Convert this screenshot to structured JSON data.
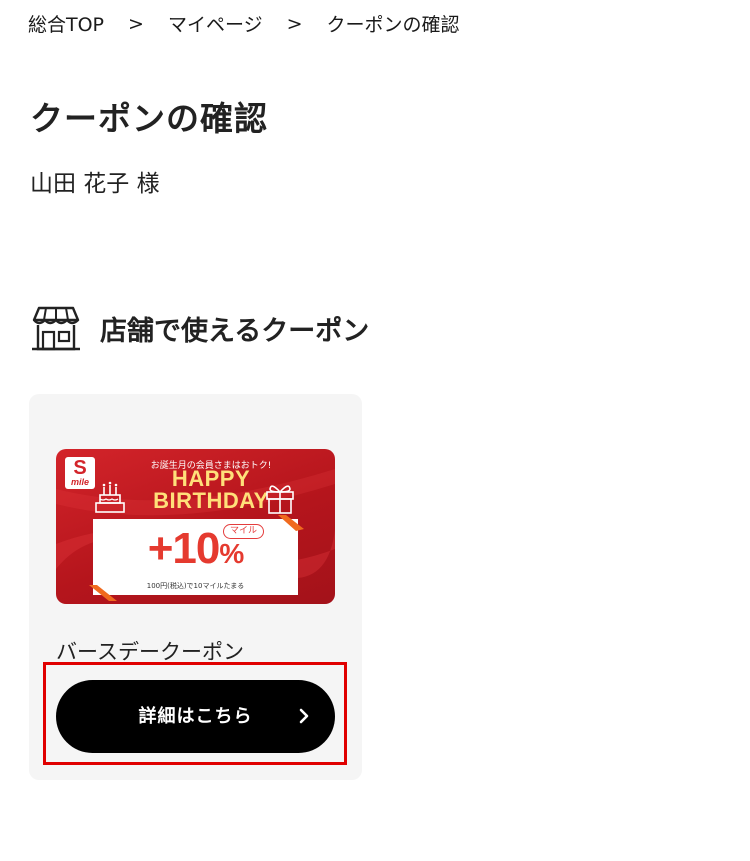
{
  "breadcrumb": {
    "items": [
      {
        "label": "総合TOP"
      },
      {
        "label": "マイページ"
      },
      {
        "label": "クーポンの確認"
      }
    ],
    "separator": ">"
  },
  "page": {
    "title": "クーポンの確認",
    "user_name": "山田 花子 様"
  },
  "section": {
    "title": "店舗で使えるクーポン",
    "icon": "storefront-icon"
  },
  "coupon": {
    "name": "バースデークーポン",
    "button_label": "詳細はこちら",
    "button_icon": "chevron-right-icon",
    "image": {
      "logo_letter": "S",
      "logo_text": "mile",
      "top_text": "お誕生月の会員さまはおトク!",
      "headline_line1": "HAPPY",
      "headline_line2": "BIRTHDAY",
      "badge": "マイル",
      "percent_value": "+10",
      "percent_sign": "%",
      "note": "100円(税込)で10マイルたまる"
    }
  },
  "colors": {
    "highlight": "#e00000",
    "button_bg": "#000000",
    "card_bg": "#f5f5f5",
    "coupon_red": "#c81e24",
    "coupon_yellow": "#ffe07a"
  }
}
